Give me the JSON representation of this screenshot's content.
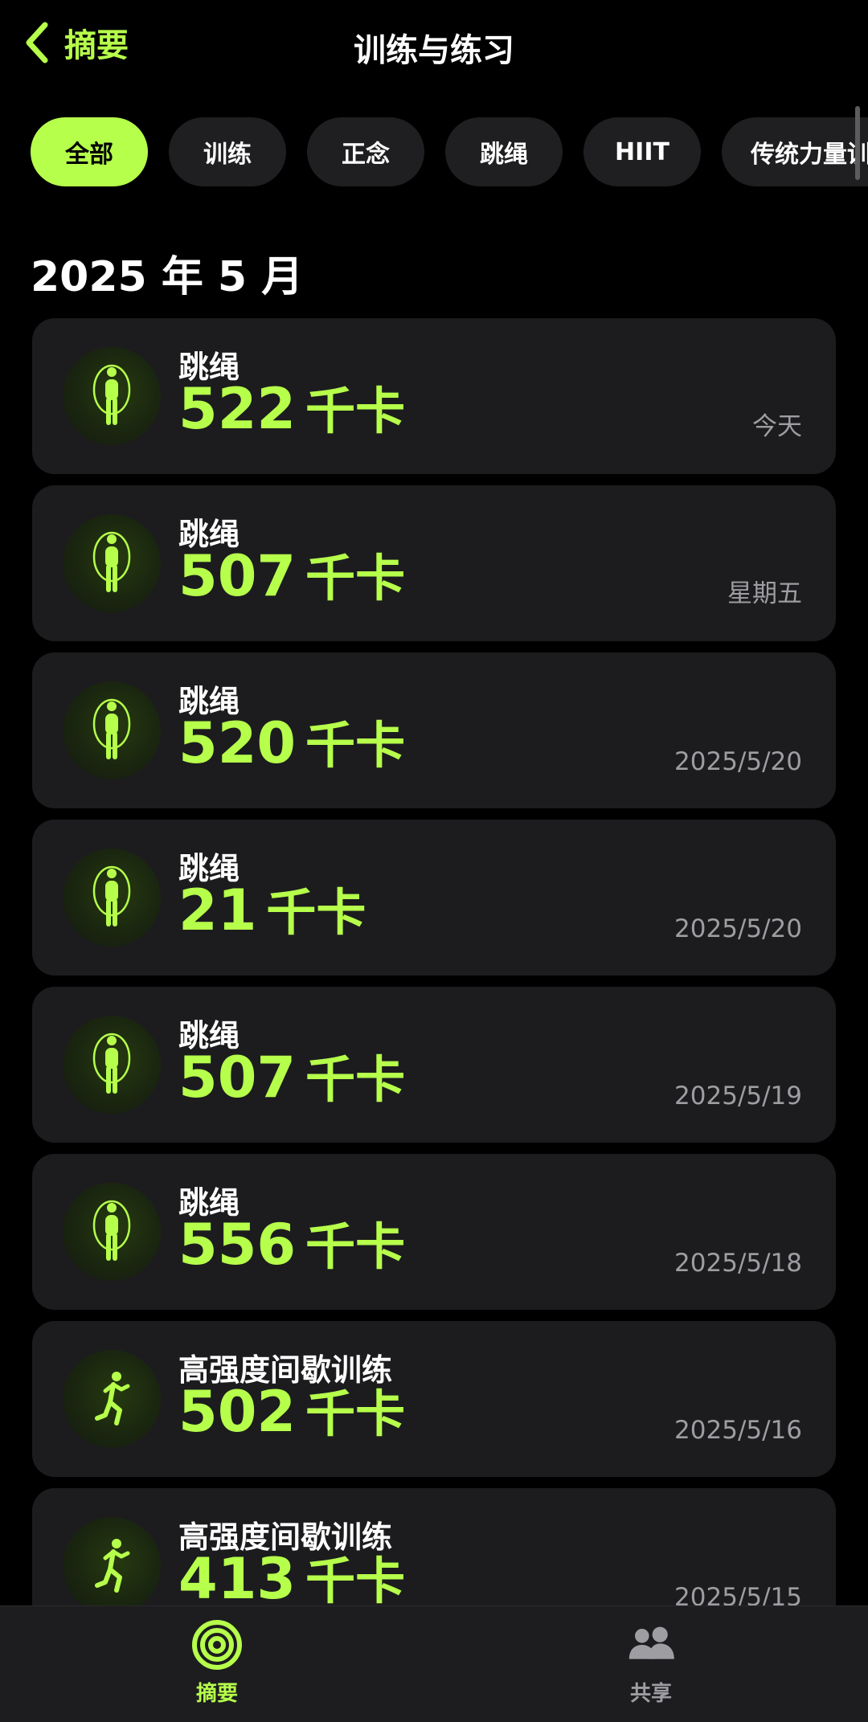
{
  "header": {
    "back_label": "摘要",
    "title": "训练与练习"
  },
  "filters": [
    "全部",
    "训练",
    "正念",
    "跳绳",
    "HIIT",
    "传统力量训练"
  ],
  "section": {
    "title": "2025 年 5 月"
  },
  "workouts": [
    {
      "name": "跳绳",
      "value": "522",
      "unit": "千卡",
      "date": "今天",
      "icon": "jump-rope-icon"
    },
    {
      "name": "跳绳",
      "value": "507",
      "unit": "千卡",
      "date": "星期五",
      "icon": "jump-rope-icon"
    },
    {
      "name": "跳绳",
      "value": "520",
      "unit": "千卡",
      "date": "2025/5/20",
      "icon": "jump-rope-icon"
    },
    {
      "name": "跳绳",
      "value": "21",
      "unit": "千卡",
      "date": "2025/5/20",
      "icon": "jump-rope-icon"
    },
    {
      "name": "跳绳",
      "value": "507",
      "unit": "千卡",
      "date": "2025/5/19",
      "icon": "jump-rope-icon"
    },
    {
      "name": "跳绳",
      "value": "556",
      "unit": "千卡",
      "date": "2025/5/18",
      "icon": "jump-rope-icon"
    },
    {
      "name": "高强度间歇训练",
      "value": "502",
      "unit": "千卡",
      "date": "2025/5/16",
      "icon": "hiit-runner-icon"
    },
    {
      "name": "高强度间歇训练",
      "value": "413",
      "unit": "千卡",
      "date": "2025/5/15",
      "icon": "hiit-runner-icon"
    }
  ],
  "tabbar": {
    "summary_label": "摘要",
    "sharing_label": "共享"
  },
  "colors": {
    "accent": "#B6FF4B",
    "card_bg": "#1C1C1E",
    "secondary_text": "#9D9DA2"
  }
}
